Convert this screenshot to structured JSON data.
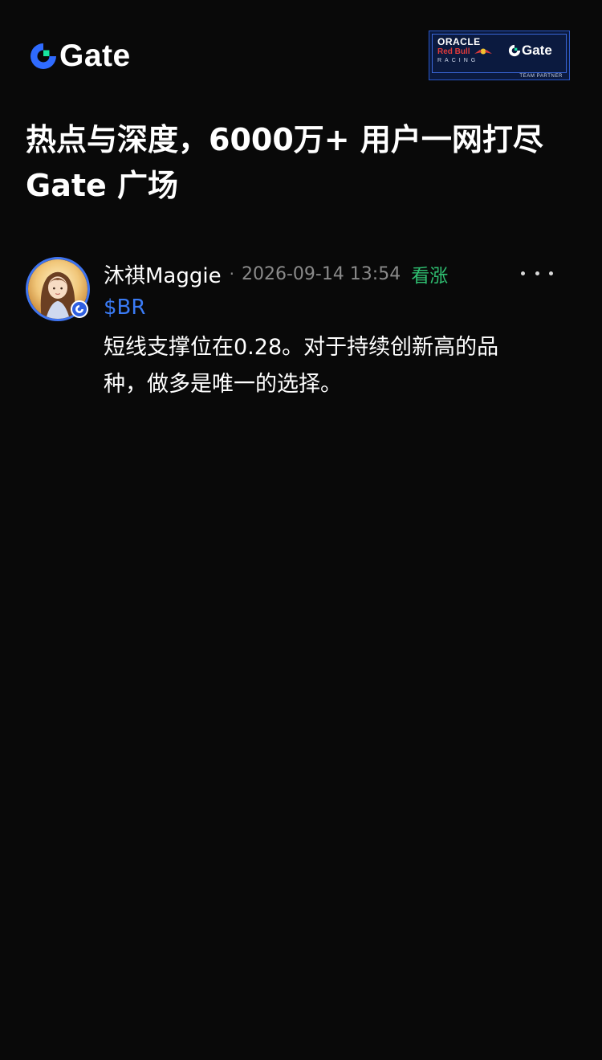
{
  "header": {
    "logo_text": "Gate",
    "partner_badge": {
      "line1": "ORACLE",
      "line2": "Red Bull",
      "line3": "RACING",
      "brand": "Gate",
      "tag": "TEAM PARTNER"
    }
  },
  "headline": {
    "line1": "热点与深度，6000万+ 用户一网打尽",
    "line2": "Gate 广场"
  },
  "post": {
    "author": "沐祺Maggie",
    "separator": "·",
    "timestamp": "2026-09-14 13:54",
    "sentiment": "看涨",
    "ticker": "$BR",
    "body_line1": "短线支撑位在0.28。对于持续创新高的品",
    "body_line2": "种，做多是唯一的选择。"
  },
  "colors": {
    "background": "#090909",
    "brand_blue": "#2f6bff",
    "brand_green": "#17e5a1",
    "sentiment_green": "#2fbf71",
    "ticker_blue": "#3a7bf5",
    "meta_gray": "#8a8a8a"
  },
  "icons": {
    "logo": "gate-logo-icon",
    "more": "more-dots-icon",
    "verified": "verified-badge-icon"
  }
}
